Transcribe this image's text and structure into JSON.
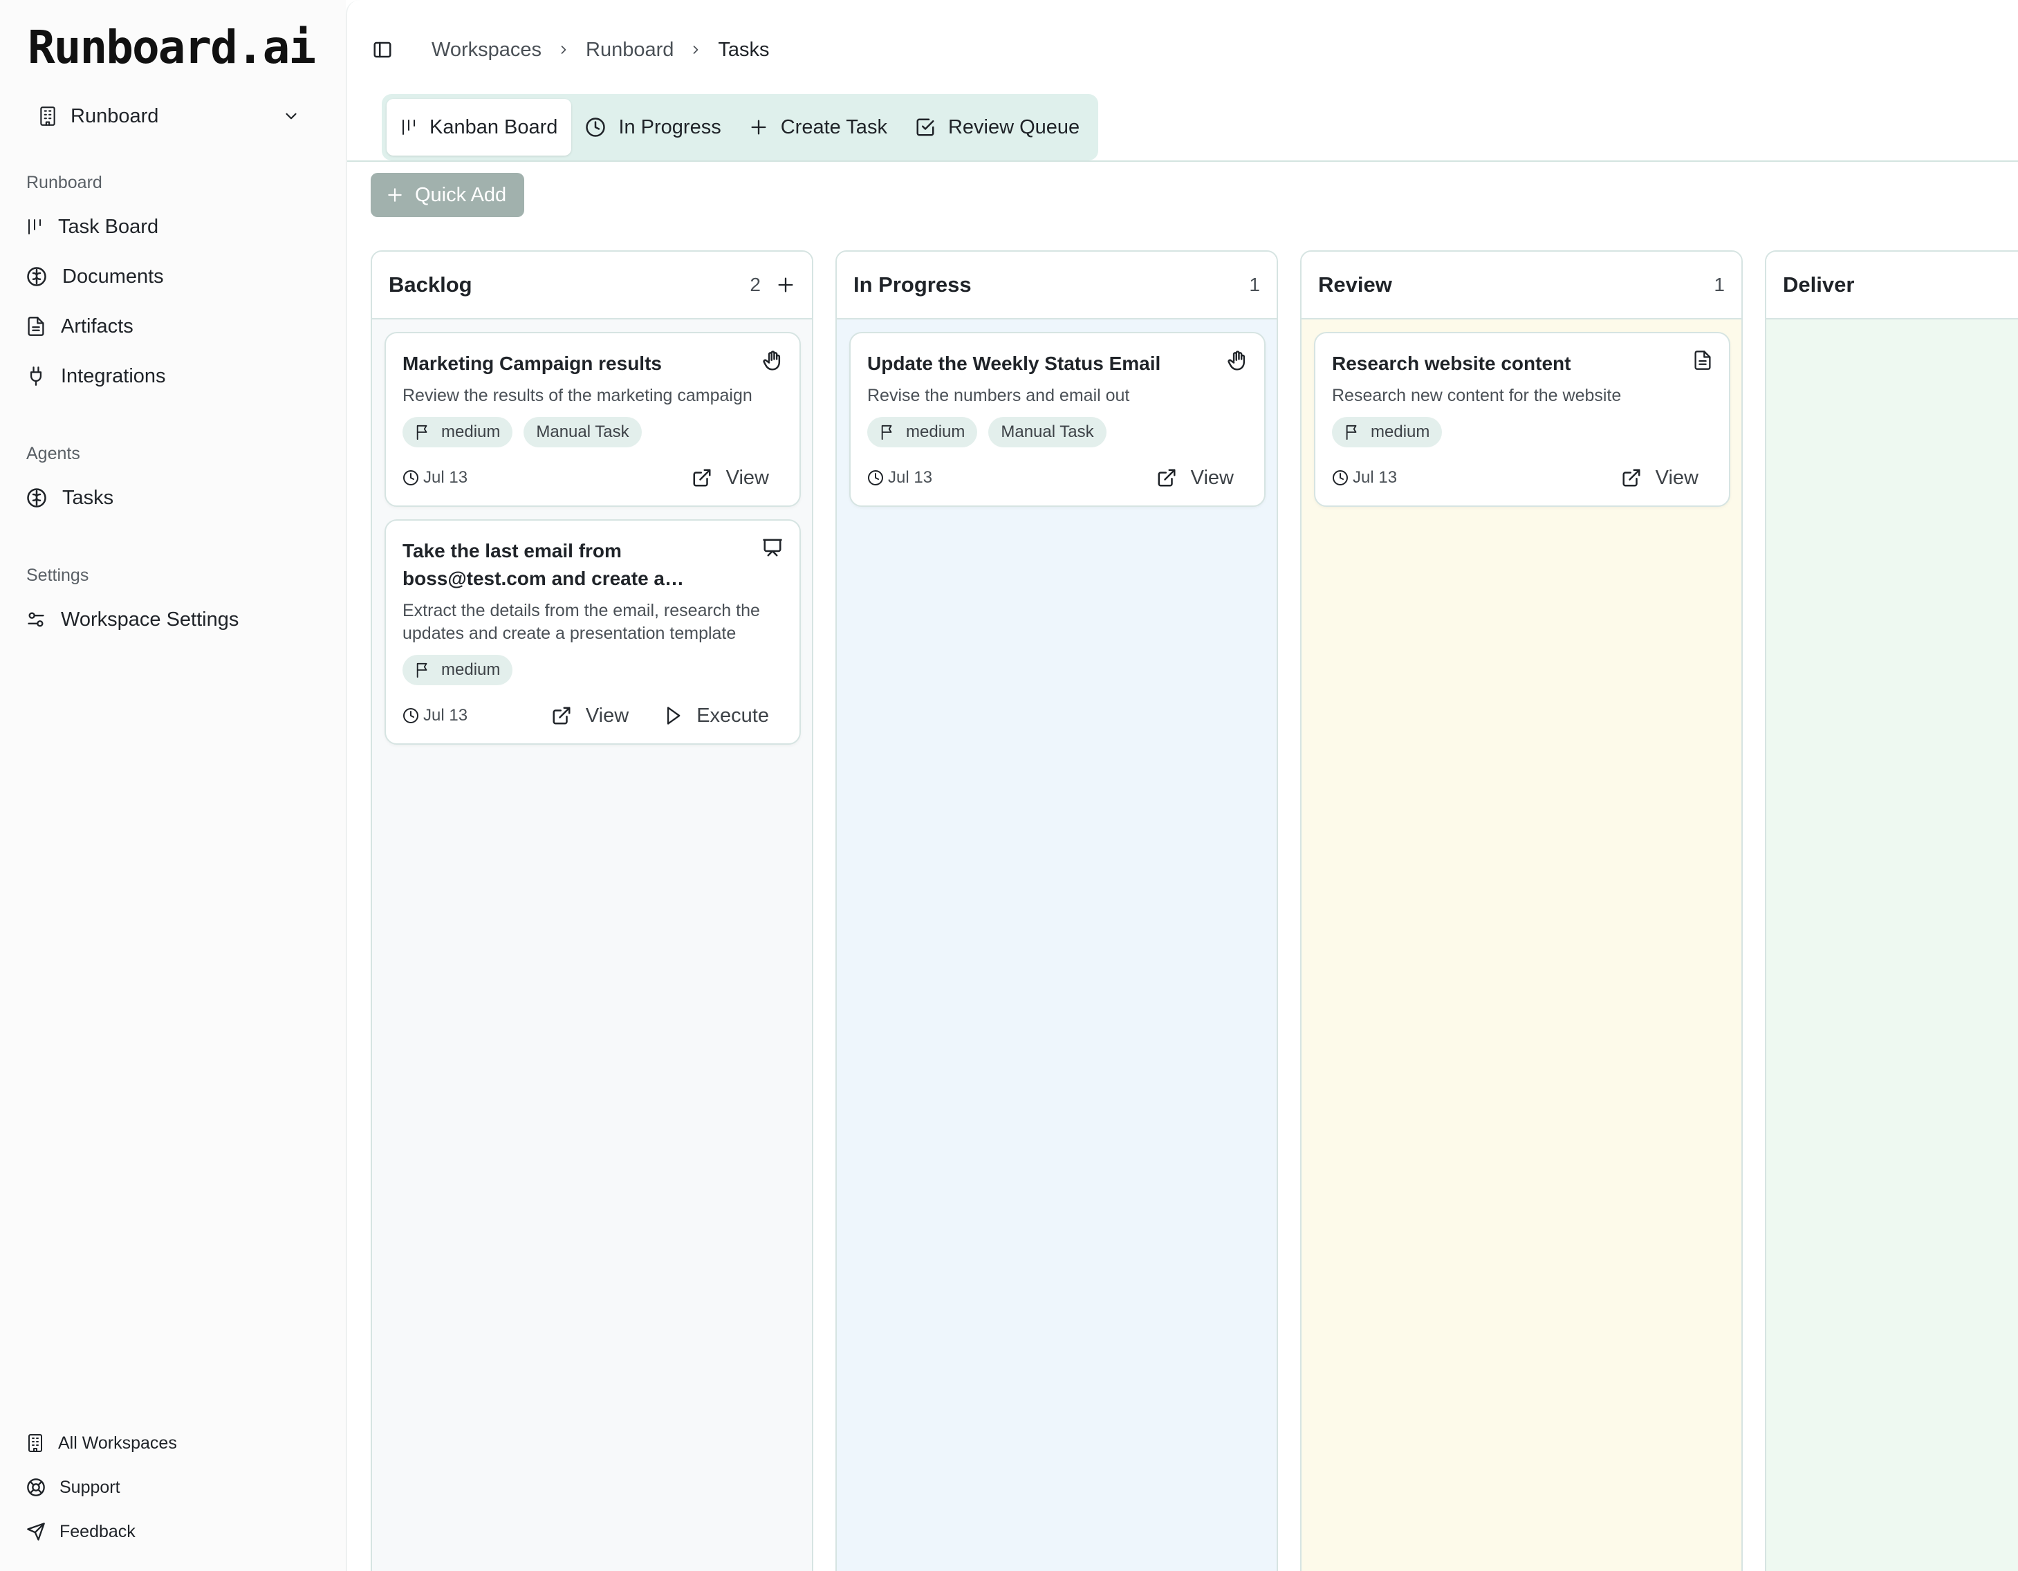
{
  "brand": {
    "logo": "Runboard.ai"
  },
  "workspace_select": {
    "value": "Runboard"
  },
  "sidebar": {
    "sections": [
      {
        "title": "Runboard",
        "items": [
          {
            "label": "Task Board",
            "icon": "kanban-icon"
          },
          {
            "label": "Documents",
            "icon": "brain-icon"
          },
          {
            "label": "Artifacts",
            "icon": "file-text-icon"
          },
          {
            "label": "Integrations",
            "icon": "plug-icon"
          }
        ]
      },
      {
        "title": "Agents",
        "items": [
          {
            "label": "Tasks",
            "icon": "brain-icon"
          }
        ]
      },
      {
        "title": "Settings",
        "items": [
          {
            "label": "Workspace Settings",
            "icon": "settings-sliders-icon"
          }
        ]
      }
    ],
    "footer": [
      {
        "label": "All Workspaces",
        "icon": "building-icon"
      },
      {
        "label": "Support",
        "icon": "life-buoy-icon"
      },
      {
        "label": "Feedback",
        "icon": "send-icon"
      }
    ]
  },
  "breadcrumb": [
    "Workspaces",
    "Runboard",
    "Tasks"
  ],
  "tabs": [
    {
      "label": "Kanban Board",
      "icon": "kanban-icon",
      "active": true
    },
    {
      "label": "In Progress",
      "icon": "clock-icon"
    },
    {
      "label": "Create Task",
      "icon": "plus-icon"
    },
    {
      "label": "Review Queue",
      "icon": "check-square-icon"
    }
  ],
  "quick_add": {
    "label": "Quick Add"
  },
  "columns": [
    {
      "title": "Backlog",
      "count": "2",
      "bg": "#f7f9fa",
      "cards": [
        {
          "title": "Marketing Campaign results",
          "title2": "",
          "desc": "Review the results of the marketing campaign",
          "tags": [
            "medium",
            "Manual Task"
          ],
          "date": "Jul 13",
          "type_icon": "hand-icon",
          "actions": [
            "View"
          ]
        },
        {
          "title": "Take the last email from",
          "title2": "boss@test.com and create a…",
          "desc": "Extract the details from the email, research the updates and create a presentation template",
          "tags": [
            "medium"
          ],
          "date": "Jul 13",
          "type_icon": "presentation-icon",
          "actions": [
            "View",
            "Execute"
          ]
        }
      ]
    },
    {
      "title": "In Progress",
      "count": "1",
      "bg": "#eef6fc",
      "cards": [
        {
          "title": "Update the Weekly Status Email",
          "title2": "",
          "desc": "Revise the numbers and email out",
          "tags": [
            "medium",
            "Manual Task"
          ],
          "date": "Jul 13",
          "type_icon": "hand-icon",
          "actions": [
            "View"
          ]
        }
      ]
    },
    {
      "title": "Review",
      "count": "1",
      "bg": "#fdfaea",
      "cards": [
        {
          "title": "Research website content",
          "title2": "",
          "desc": "Research new content for the website",
          "tags": [
            "medium"
          ],
          "date": "Jul 13",
          "type_icon": "file-text-icon",
          "actions": [
            "View"
          ]
        }
      ]
    },
    {
      "title": "Deliver",
      "count": "",
      "bg": "#eef9f1",
      "cards": []
    }
  ]
}
